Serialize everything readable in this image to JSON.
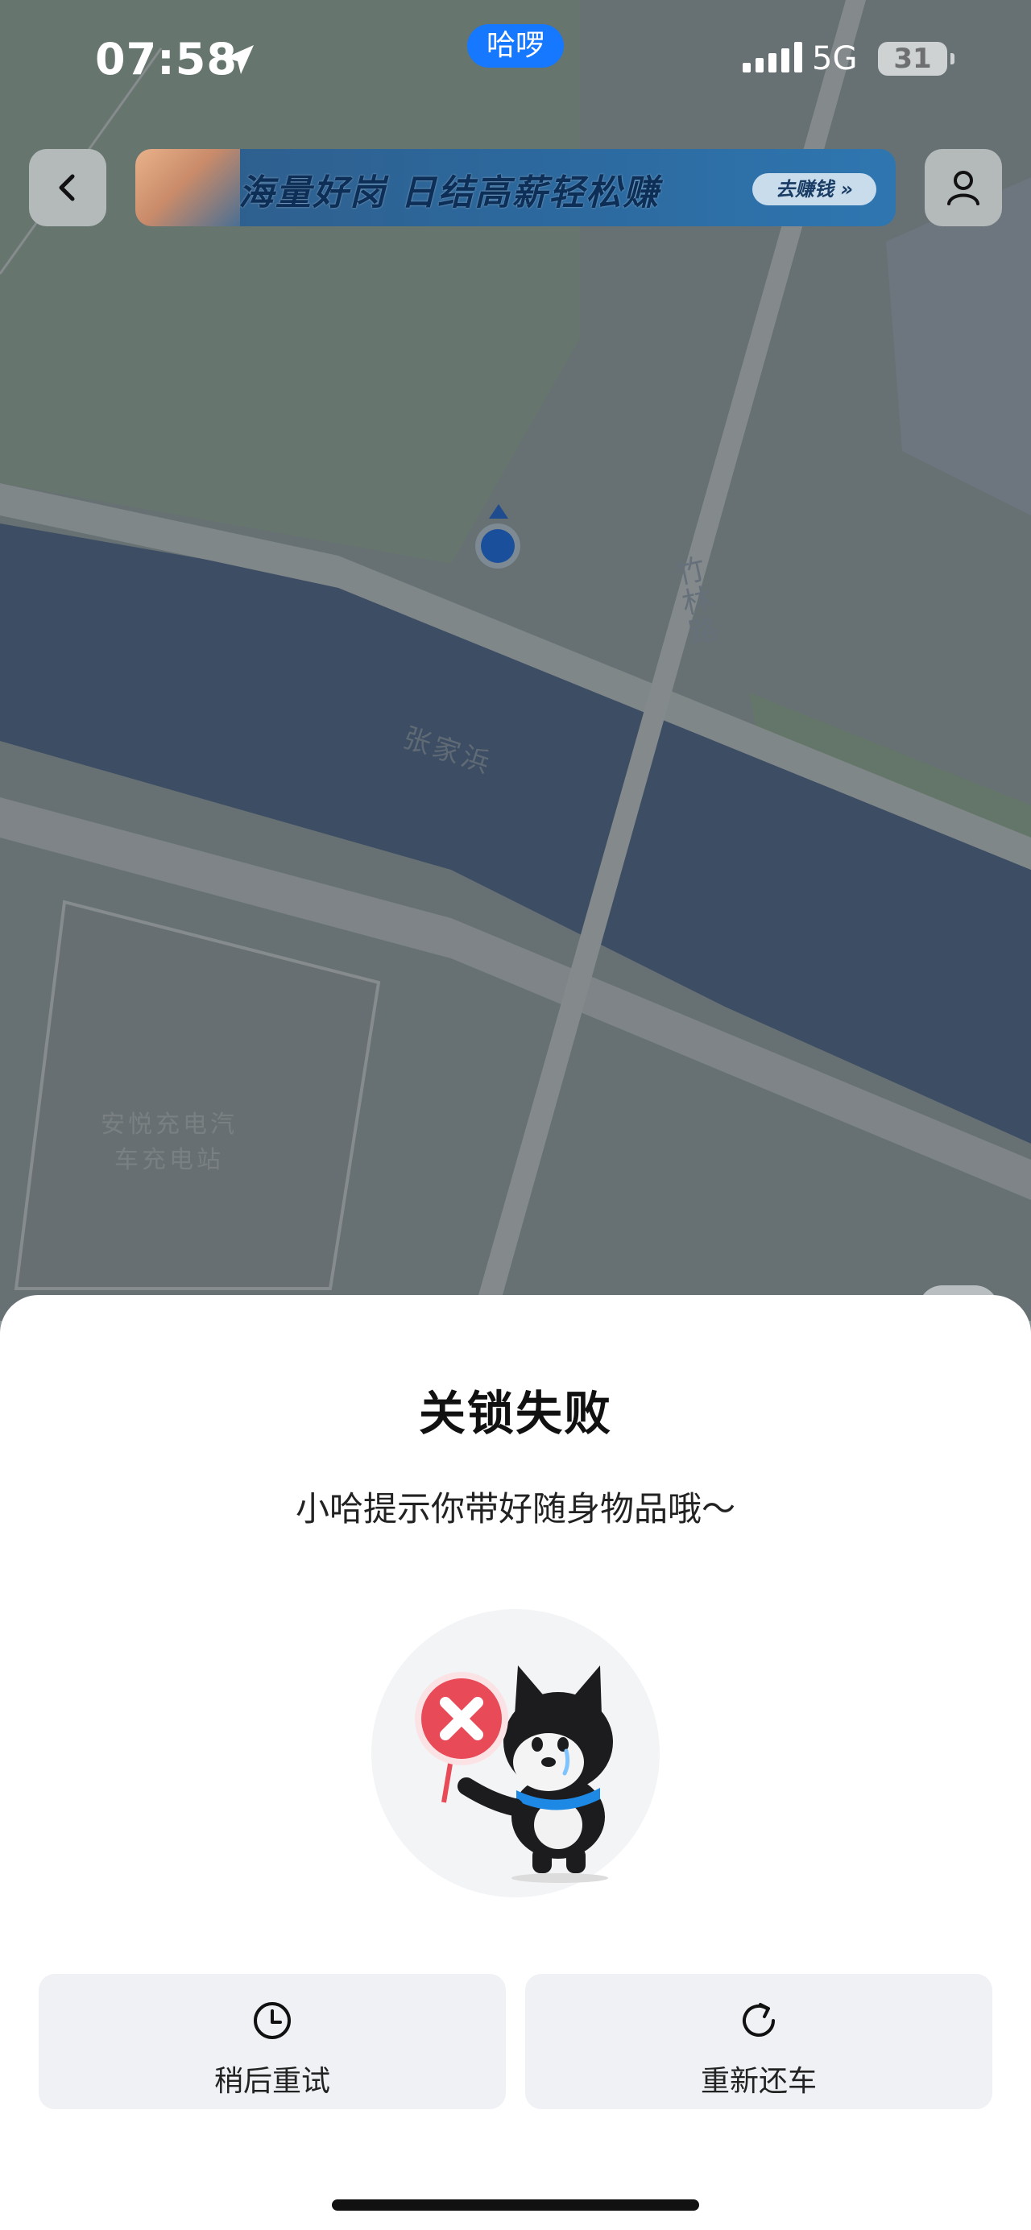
{
  "status_bar": {
    "time": "07:58",
    "app_pill": "哈啰",
    "network": "5G",
    "battery": "31"
  },
  "header": {
    "banner_text": "海量好岗 日结高薪轻松赚",
    "banner_cta": "去赚钱 »"
  },
  "map": {
    "labels": {
      "river": "张家浜",
      "road": "竹林路",
      "poi": "安悦充电汽车充电站"
    },
    "colors": {
      "river": "#4a5e7a",
      "land": "#7f8a8c",
      "road": "#a9b0b2"
    }
  },
  "dialog": {
    "title": "关锁失败",
    "message": "小哈提示你带好随身物品哦～",
    "actions": [
      {
        "label": "稍后重试",
        "icon": "clock-icon"
      },
      {
        "label": "重新还车",
        "icon": "refresh-icon"
      }
    ]
  },
  "colors": {
    "accent": "#1677ff",
    "error": "#e84a57"
  }
}
